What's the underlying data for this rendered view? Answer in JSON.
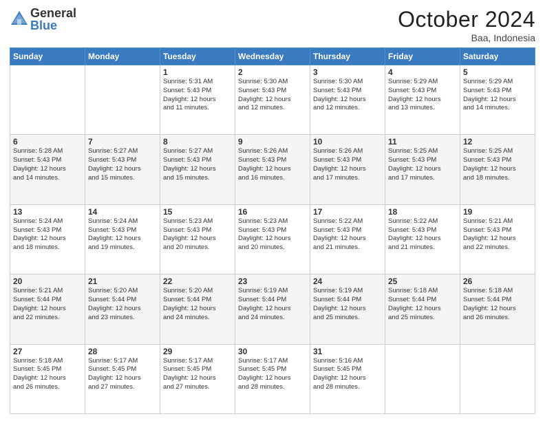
{
  "header": {
    "logo_general": "General",
    "logo_blue": "Blue",
    "month_title": "October 2024",
    "location": "Baa, Indonesia"
  },
  "days_of_week": [
    "Sunday",
    "Monday",
    "Tuesday",
    "Wednesday",
    "Thursday",
    "Friday",
    "Saturday"
  ],
  "weeks": [
    [
      {
        "day": "",
        "info": ""
      },
      {
        "day": "",
        "info": ""
      },
      {
        "day": "1",
        "info": "Sunrise: 5:31 AM\nSunset: 5:43 PM\nDaylight: 12 hours\nand 11 minutes."
      },
      {
        "day": "2",
        "info": "Sunrise: 5:30 AM\nSunset: 5:43 PM\nDaylight: 12 hours\nand 12 minutes."
      },
      {
        "day": "3",
        "info": "Sunrise: 5:30 AM\nSunset: 5:43 PM\nDaylight: 12 hours\nand 12 minutes."
      },
      {
        "day": "4",
        "info": "Sunrise: 5:29 AM\nSunset: 5:43 PM\nDaylight: 12 hours\nand 13 minutes."
      },
      {
        "day": "5",
        "info": "Sunrise: 5:29 AM\nSunset: 5:43 PM\nDaylight: 12 hours\nand 14 minutes."
      }
    ],
    [
      {
        "day": "6",
        "info": "Sunrise: 5:28 AM\nSunset: 5:43 PM\nDaylight: 12 hours\nand 14 minutes."
      },
      {
        "day": "7",
        "info": "Sunrise: 5:27 AM\nSunset: 5:43 PM\nDaylight: 12 hours\nand 15 minutes."
      },
      {
        "day": "8",
        "info": "Sunrise: 5:27 AM\nSunset: 5:43 PM\nDaylight: 12 hours\nand 15 minutes."
      },
      {
        "day": "9",
        "info": "Sunrise: 5:26 AM\nSunset: 5:43 PM\nDaylight: 12 hours\nand 16 minutes."
      },
      {
        "day": "10",
        "info": "Sunrise: 5:26 AM\nSunset: 5:43 PM\nDaylight: 12 hours\nand 17 minutes."
      },
      {
        "day": "11",
        "info": "Sunrise: 5:25 AM\nSunset: 5:43 PM\nDaylight: 12 hours\nand 17 minutes."
      },
      {
        "day": "12",
        "info": "Sunrise: 5:25 AM\nSunset: 5:43 PM\nDaylight: 12 hours\nand 18 minutes."
      }
    ],
    [
      {
        "day": "13",
        "info": "Sunrise: 5:24 AM\nSunset: 5:43 PM\nDaylight: 12 hours\nand 18 minutes."
      },
      {
        "day": "14",
        "info": "Sunrise: 5:24 AM\nSunset: 5:43 PM\nDaylight: 12 hours\nand 19 minutes."
      },
      {
        "day": "15",
        "info": "Sunrise: 5:23 AM\nSunset: 5:43 PM\nDaylight: 12 hours\nand 20 minutes."
      },
      {
        "day": "16",
        "info": "Sunrise: 5:23 AM\nSunset: 5:43 PM\nDaylight: 12 hours\nand 20 minutes."
      },
      {
        "day": "17",
        "info": "Sunrise: 5:22 AM\nSunset: 5:43 PM\nDaylight: 12 hours\nand 21 minutes."
      },
      {
        "day": "18",
        "info": "Sunrise: 5:22 AM\nSunset: 5:43 PM\nDaylight: 12 hours\nand 21 minutes."
      },
      {
        "day": "19",
        "info": "Sunrise: 5:21 AM\nSunset: 5:43 PM\nDaylight: 12 hours\nand 22 minutes."
      }
    ],
    [
      {
        "day": "20",
        "info": "Sunrise: 5:21 AM\nSunset: 5:44 PM\nDaylight: 12 hours\nand 22 minutes."
      },
      {
        "day": "21",
        "info": "Sunrise: 5:20 AM\nSunset: 5:44 PM\nDaylight: 12 hours\nand 23 minutes."
      },
      {
        "day": "22",
        "info": "Sunrise: 5:20 AM\nSunset: 5:44 PM\nDaylight: 12 hours\nand 24 minutes."
      },
      {
        "day": "23",
        "info": "Sunrise: 5:19 AM\nSunset: 5:44 PM\nDaylight: 12 hours\nand 24 minutes."
      },
      {
        "day": "24",
        "info": "Sunrise: 5:19 AM\nSunset: 5:44 PM\nDaylight: 12 hours\nand 25 minutes."
      },
      {
        "day": "25",
        "info": "Sunrise: 5:18 AM\nSunset: 5:44 PM\nDaylight: 12 hours\nand 25 minutes."
      },
      {
        "day": "26",
        "info": "Sunrise: 5:18 AM\nSunset: 5:44 PM\nDaylight: 12 hours\nand 26 minutes."
      }
    ],
    [
      {
        "day": "27",
        "info": "Sunrise: 5:18 AM\nSunset: 5:45 PM\nDaylight: 12 hours\nand 26 minutes."
      },
      {
        "day": "28",
        "info": "Sunrise: 5:17 AM\nSunset: 5:45 PM\nDaylight: 12 hours\nand 27 minutes."
      },
      {
        "day": "29",
        "info": "Sunrise: 5:17 AM\nSunset: 5:45 PM\nDaylight: 12 hours\nand 27 minutes."
      },
      {
        "day": "30",
        "info": "Sunrise: 5:17 AM\nSunset: 5:45 PM\nDaylight: 12 hours\nand 28 minutes."
      },
      {
        "day": "31",
        "info": "Sunrise: 5:16 AM\nSunset: 5:45 PM\nDaylight: 12 hours\nand 28 minutes."
      },
      {
        "day": "",
        "info": ""
      },
      {
        "day": "",
        "info": ""
      }
    ]
  ]
}
